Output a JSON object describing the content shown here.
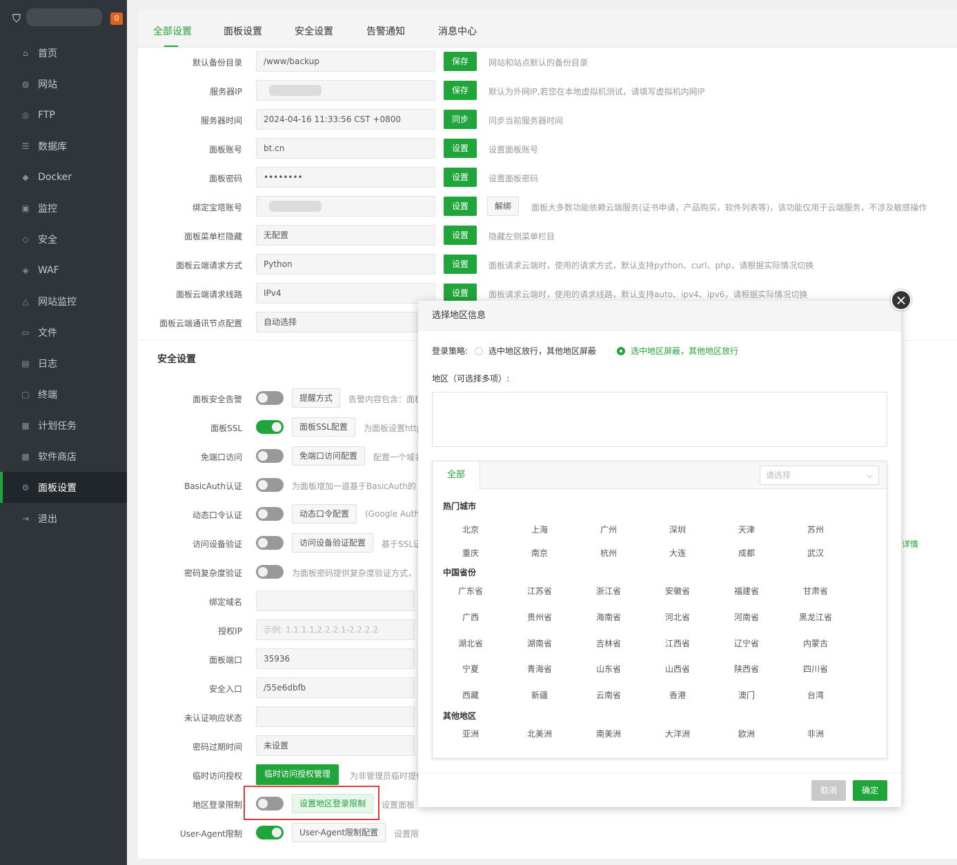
{
  "sidebar": {
    "badge": "0",
    "items": [
      {
        "label": "首页",
        "icon": "home-icon",
        "glyph": "⌂"
      },
      {
        "label": "网站",
        "icon": "globe-icon",
        "glyph": "◍"
      },
      {
        "label": "FTP",
        "icon": "ftp-icon",
        "glyph": "◎"
      },
      {
        "label": "数据库",
        "icon": "database-icon",
        "glyph": "☰"
      },
      {
        "label": "Docker",
        "icon": "docker-icon",
        "glyph": "◆"
      },
      {
        "label": "监控",
        "icon": "monitor-icon",
        "glyph": "▣"
      },
      {
        "label": "安全",
        "icon": "shield-icon",
        "glyph": "◇"
      },
      {
        "label": "WAF",
        "icon": "waf-icon",
        "glyph": "◈"
      },
      {
        "label": "网站监控",
        "icon": "site-monitor-icon",
        "glyph": "△"
      },
      {
        "label": "文件",
        "icon": "folder-icon",
        "glyph": "▭"
      },
      {
        "label": "日志",
        "icon": "log-icon",
        "glyph": "▤"
      },
      {
        "label": "终端",
        "icon": "terminal-icon",
        "glyph": "▢"
      },
      {
        "label": "计划任务",
        "icon": "calendar-icon",
        "glyph": "▦"
      },
      {
        "label": "软件商店",
        "icon": "apps-icon",
        "glyph": "▩"
      },
      {
        "label": "面板设置",
        "icon": "gear-icon",
        "glyph": "⚙"
      },
      {
        "label": "退出",
        "icon": "logout-icon",
        "glyph": "⇥"
      }
    ]
  },
  "tabs": [
    "全部设置",
    "面板设置",
    "安全设置",
    "告警通知",
    "消息中心"
  ],
  "panel_rows": [
    {
      "label": "默认备份目录",
      "value": "/www/backup",
      "btn": "保存",
      "desc": "网站和站点默认的备份目录"
    },
    {
      "label": "服务器IP",
      "value": "",
      "btn": "保存",
      "desc": "默认为外网IP,若您在本地虚拟机测试，请填写虚拟机内网IP"
    },
    {
      "label": "服务器时间",
      "value": "2024-04-16 11:33:56 CST +0800",
      "btn": "同步",
      "desc": "同步当前服务器时间"
    },
    {
      "label": "面板账号",
      "value": "bt.cn",
      "btn": "设置",
      "desc": "设置面板账号"
    },
    {
      "label": "面板密码",
      "value": "••••••••",
      "btn": "设置",
      "desc": "设置面板密码"
    },
    {
      "label": "绑定宝塔账号",
      "value": "",
      "btn": "设置",
      "btn2": "解绑",
      "desc": "面板大多数功能依赖云端服务(证书申请，产品购买，软件列表等)，该功能仅用于云端服务，不涉及敏感操作"
    },
    {
      "label": "面板菜单栏隐藏",
      "value": "无配置",
      "btn": "设置",
      "desc": "隐藏左侧菜单栏目"
    },
    {
      "label": "面板云端请求方式",
      "value": "Python",
      "btn": "设置",
      "desc": "面板请求云端时，使用的请求方式，默认支持python、curl、php，请根据实际情况切换"
    },
    {
      "label": "面板云端请求线路",
      "value": "IPv4",
      "btn": "设置",
      "desc": "面板请求云端时，使用的请求线路，默认支持auto、ipv4、ipv6，请根据实际情况切换"
    },
    {
      "label": "面板云端通讯节点配置",
      "value": "自动选择",
      "btn": "",
      "desc": ""
    }
  ],
  "security_title": "安全设置",
  "security_rows": [
    {
      "label": "面板安全告警",
      "toggle": false,
      "btn": "提醒方式",
      "desc": "告警内容包含：面板"
    },
    {
      "label": "面板SSL",
      "toggle": true,
      "btn": "面板SSL配置",
      "desc": "为面板设置https"
    },
    {
      "label": "免端口访问",
      "toggle": false,
      "btn": "免端口访问配置",
      "desc": "配置一个域名"
    },
    {
      "label": "BasicAuth认证",
      "toggle": false,
      "btn": "",
      "desc": "为面板增加一道基于BasicAuth的"
    },
    {
      "label": "动态口令认证",
      "toggle": false,
      "btn": "动态口令配置",
      "desc": "(Google Auth"
    },
    {
      "label": "访问设备验证",
      "toggle": false,
      "btn": "访问设备验证配置",
      "desc": "基于SSL证"
    },
    {
      "label": "密码复杂度验证",
      "toggle": false,
      "btn": "",
      "desc": "为面板密码提供复杂度验证方式，"
    },
    {
      "label": "绑定域名",
      "input": ""
    },
    {
      "label": "授权IP",
      "input": "",
      "placeholder": "示例: 1.1.1.1,2.2.2.1-2.2.2.2"
    },
    {
      "label": "面板端口",
      "input": "35936"
    },
    {
      "label": "安全入口",
      "input": "/55e6dbfb"
    },
    {
      "label": "未认证响应状态",
      "input": ""
    },
    {
      "label": "密码过期时间",
      "input": "未设置"
    },
    {
      "label": "临时访问授权",
      "greenbtn": "临时访问授权管理",
      "desc": "为非管理员临时提供"
    },
    {
      "label": "地区登录限制",
      "toggle": false,
      "btn": "设置地区登录限制",
      "btnGreen": true,
      "desc": "设置面板"
    },
    {
      "label": "User-Agent限制",
      "toggle": true,
      "btn": "User-Agent限制配置",
      "desc": "设置限制访问User-Agent"
    }
  ],
  "side_link": "详情",
  "dialog": {
    "title": "选择地区信息",
    "policy_label": "登录策略:",
    "option1": "选中地区放行，其他地区屏蔽",
    "option2": "选中地区屏蔽，其他地区放行",
    "area_label": "地区（可选择多项）:",
    "tab_all": "全部",
    "select_placeholder": "请选择",
    "groups": [
      {
        "title": "热门城市",
        "items": [
          "北京",
          "上海",
          "广州",
          "深圳",
          "天津",
          "苏州",
          "重庆",
          "南京",
          "杭州",
          "大连",
          "成都",
          "武汉"
        ]
      },
      {
        "title": "中国省份",
        "items": [
          "广东省",
          "江苏省",
          "浙江省",
          "安徽省",
          "福建省",
          "甘肃省",
          "广西",
          "贵州省",
          "海南省",
          "河北省",
          "河南省",
          "黑龙江省",
          "湖北省",
          "湖南省",
          "吉林省",
          "江西省",
          "辽宁省",
          "内蒙古",
          "宁夏",
          "青海省",
          "山东省",
          "山西省",
          "陕西省",
          "四川省",
          "西藏",
          "新疆",
          "云南省",
          "香港",
          "澳门",
          "台湾"
        ]
      },
      {
        "title": "其他地区",
        "items": [
          "亚洲",
          "北美洲",
          "南美洲",
          "大洋洲",
          "欧洲",
          "非洲"
        ]
      }
    ],
    "cancel": "取消",
    "ok": "确定"
  },
  "colors": {
    "accent": "#20a53a",
    "sidebar": "#2f353a",
    "highlight": "#e53935"
  }
}
